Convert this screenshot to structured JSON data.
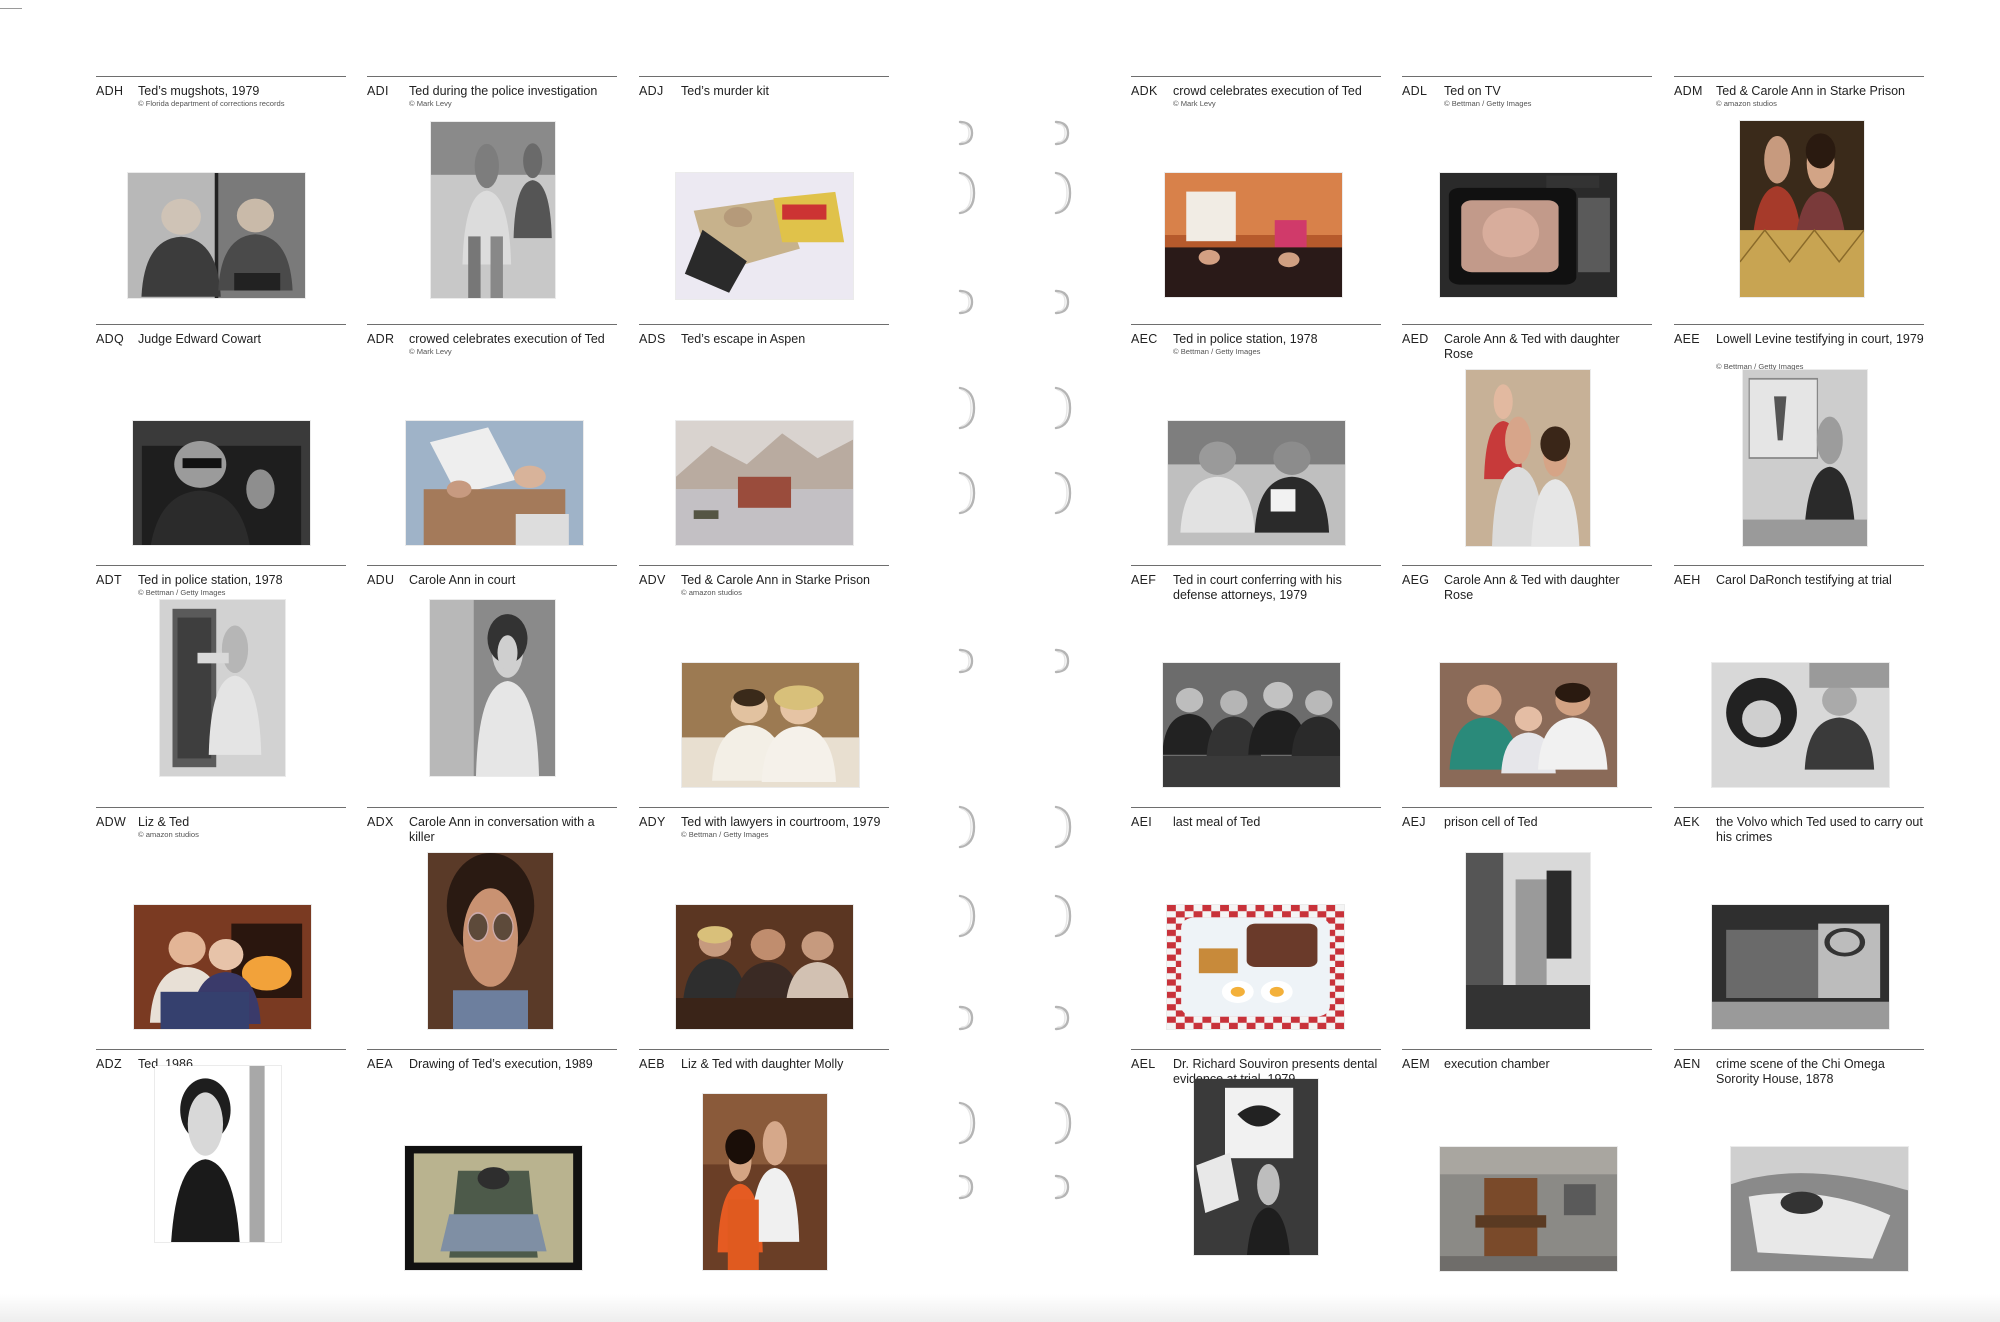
{
  "pages": [
    {
      "cells": [
        {
          "code": "ADH",
          "caption": "Ted’s mugshots, 1979",
          "credit": "© Florida department of corrections records",
          "photo": "mugshots"
        },
        {
          "code": "ADI",
          "caption": "Ted during the police investigation",
          "credit": "© Mark Levy",
          "photo": "walking-bw"
        },
        {
          "code": "ADJ",
          "caption": "Ted’s murder kit",
          "credit": "",
          "photo": "kit"
        },
        {
          "code": "ADQ",
          "caption": "Judge Edward Cowart",
          "credit": "",
          "photo": "judge"
        },
        {
          "code": "ADR",
          "caption": "crowed celebrates execution of Ted",
          "credit": "© Mark Levy",
          "photo": "crowd-sign"
        },
        {
          "code": "ADS",
          "caption": "Ted’s escape in Aspen",
          "credit": "",
          "photo": "aspen"
        },
        {
          "code": "ADT",
          "caption": "Ted in police station, 1978",
          "credit": "© Bettman / Getty Images",
          "photo": "doorway-bw"
        },
        {
          "code": "ADU",
          "caption": "Carole Ann in court",
          "credit": "",
          "photo": "carole-bw"
        },
        {
          "code": "ADV",
          "caption": "Ted & Carole Ann in Starke Prison",
          "credit": "© amazon studios",
          "photo": "couple-warm"
        },
        {
          "code": "ADW",
          "caption": "Liz & Ted",
          "credit": "© amazon studios",
          "photo": "fireplace"
        },
        {
          "code": "ADX",
          "caption": "Carole Ann in conversation with a killer",
          "credit": "",
          "photo": "carole-closeup"
        },
        {
          "code": "ADY",
          "caption": "Ted with lawyers in courtroom, 1979",
          "credit": "© Bettman / Getty Images",
          "photo": "courtroom-color"
        },
        {
          "code": "ADZ",
          "caption": "Ted, 1986",
          "credit": "",
          "photo": "portrait-bw"
        },
        {
          "code": "AEA",
          "caption": "Drawing of Ted’s execution, 1989",
          "credit": "",
          "photo": "drawing"
        },
        {
          "code": "AEB",
          "caption": "Liz & Ted with daughter Molly",
          "credit": "",
          "photo": "family-orange"
        }
      ]
    },
    {
      "cells": [
        {
          "code": "ADK",
          "caption": "crowd celebrates execution of Ted",
          "credit": "© Mark Levy",
          "photo": "crowd-sunset"
        },
        {
          "code": "ADL",
          "caption": "Ted on TV",
          "credit": "© Bettman / Getty Images",
          "photo": "tv"
        },
        {
          "code": "ADM",
          "caption": "Ted & Carole Ann in Starke Prison",
          "credit": "© amazon studios",
          "photo": "prison-visit"
        },
        {
          "code": "AEC",
          "caption": "Ted in police station, 1978",
          "credit": "© Bettman / Getty Images",
          "photo": "station-bw"
        },
        {
          "code": "AED",
          "caption": "Carole Ann & Ted with daughter Rose",
          "credit": "",
          "photo": "family-rose"
        },
        {
          "code": "AEE",
          "caption": "Lowell Levine testifying in court, 1979",
          "credit": "© Bettman / Getty Images",
          "photo": "testify-bw"
        },
        {
          "code": "AEF",
          "caption": "Ted in court conferring with his defense attorneys, 1979",
          "credit": "",
          "photo": "court-bw"
        },
        {
          "code": "AEG",
          "caption": "Carole Ann & Ted with daughter Rose",
          "credit": "",
          "photo": "family-green"
        },
        {
          "code": "AEH",
          "caption": "Carol DaRonch testifying at trial",
          "credit": "",
          "photo": "daronch-bw"
        },
        {
          "code": "AEI",
          "caption": "last meal of Ted",
          "credit": "",
          "photo": "meal"
        },
        {
          "code": "AEJ",
          "caption": "prison cell of Ted",
          "credit": "",
          "photo": "cell-bw"
        },
        {
          "code": "AEK",
          "caption": "the Volvo which Ted used to carry out his crimes",
          "credit": "",
          "photo": "volvo-bw"
        },
        {
          "code": "AEL",
          "caption": "Dr. Richard Souviron presents dental evidence at trial, 1979",
          "credit": "",
          "photo": "dental-bw"
        },
        {
          "code": "AEM",
          "caption": "execution chamber",
          "credit": "",
          "photo": "chair"
        },
        {
          "code": "AEN",
          "caption": "crime scene of the Chi Omega Sorority House, 1878",
          "credit": "",
          "photo": "crime-bw"
        }
      ]
    }
  ]
}
